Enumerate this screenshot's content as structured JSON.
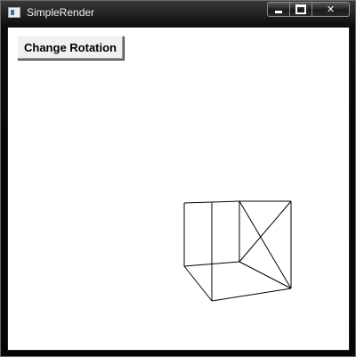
{
  "window": {
    "title": "SimpleRender",
    "icon": "app-window-icon",
    "controls": {
      "minimize_icon": "minimize-icon",
      "maximize_icon": "maximize-icon",
      "close_icon": "close-icon",
      "close_glyph": "✕"
    }
  },
  "toolbar": {
    "change_rotation_label": "Change Rotation"
  },
  "colors": {
    "client_background": "#ffffff",
    "wireframe": "#000000"
  }
}
